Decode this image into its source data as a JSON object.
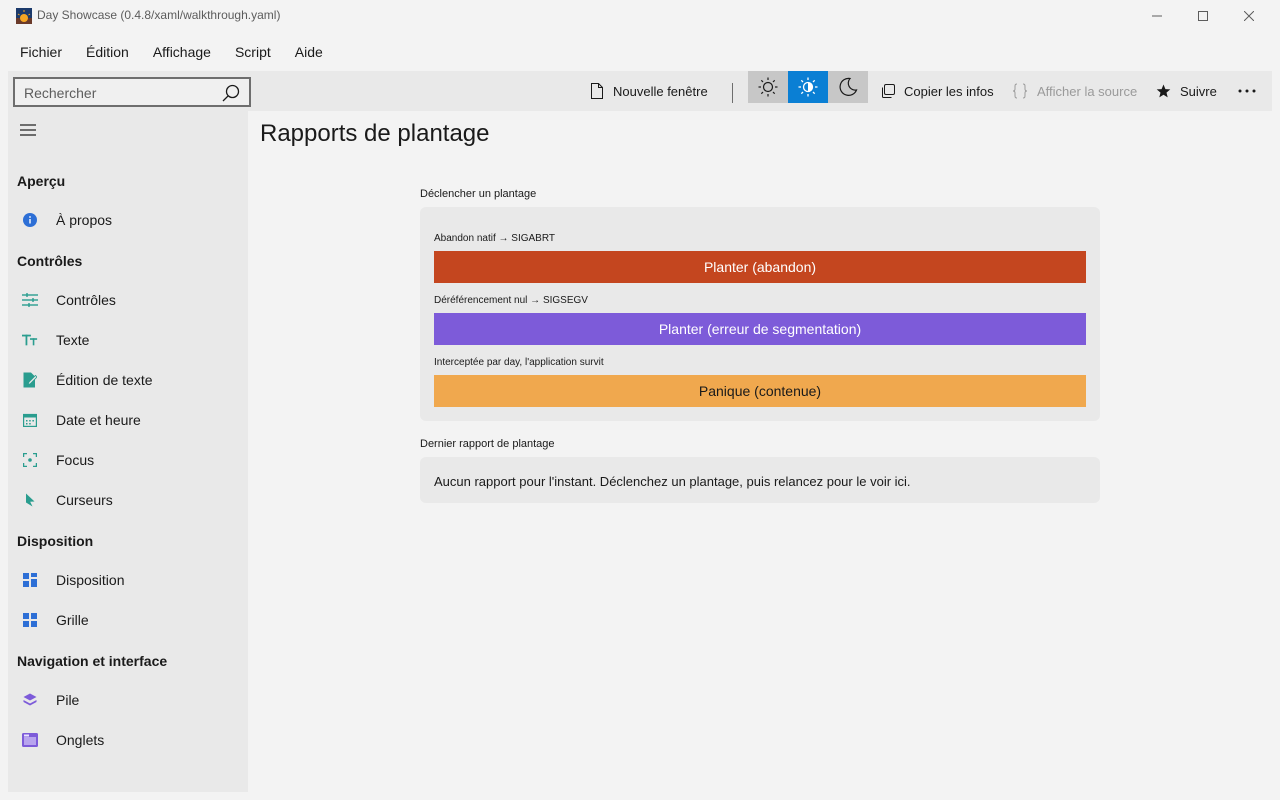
{
  "window": {
    "title": "Day Showcase (0.4.8/xaml/walkthrough.yaml)"
  },
  "menu": [
    "Fichier",
    "Édition",
    "Affichage",
    "Script",
    "Aide"
  ],
  "toolbar": {
    "search_placeholder": "Rechercher",
    "new_window": "Nouvelle fenêtre",
    "copy_info": "Copier les infos",
    "show_source": "Afficher la source",
    "follow": "Suivre",
    "accent_color": "#0a7fd4"
  },
  "sidebar": {
    "groups": [
      {
        "label": "Aperçu",
        "items": [
          {
            "label": "À propos",
            "icon": "info-icon"
          }
        ]
      },
      {
        "label": "Contrôles",
        "items": [
          {
            "label": "Contrôles",
            "icon": "sliders-icon"
          },
          {
            "label": "Texte",
            "icon": "text-icon"
          },
          {
            "label": "Édition de texte",
            "icon": "edit-icon"
          },
          {
            "label": "Date et heure",
            "icon": "calendar-icon"
          },
          {
            "label": "Focus",
            "icon": "focus-icon"
          },
          {
            "label": "Curseurs",
            "icon": "cursor-icon"
          }
        ]
      },
      {
        "label": "Disposition",
        "items": [
          {
            "label": "Disposition",
            "icon": "layout-icon"
          },
          {
            "label": "Grille",
            "icon": "grid-icon"
          }
        ]
      },
      {
        "label": "Navigation et interface",
        "items": [
          {
            "label": "Pile",
            "icon": "stack-icon"
          },
          {
            "label": "Onglets",
            "icon": "tabs-icon"
          }
        ]
      }
    ]
  },
  "main": {
    "title": "Rapports de plantage",
    "trigger_section": "Déclencher un plantage",
    "buttons": [
      {
        "caption": "Abandon natif → SIGABRT",
        "label": "Planter (abandon)",
        "color": "#c4461f",
        "text_color": "#ffffff"
      },
      {
        "caption": "Déréférencement nul → SIGSEGV",
        "label": "Planter (erreur de segmentation)",
        "color": "#7d5bd9",
        "text_color": "#ffffff"
      },
      {
        "caption": "Interceptée par day, l'application survit",
        "label": "Panique (contenue)",
        "color": "#f0a84e",
        "text_color": "#1a1a1a"
      }
    ],
    "report_section": "Dernier rapport de plantage",
    "report_text": "Aucun rapport pour l'instant. Déclenchez un plantage, puis relancez pour le voir ici."
  }
}
